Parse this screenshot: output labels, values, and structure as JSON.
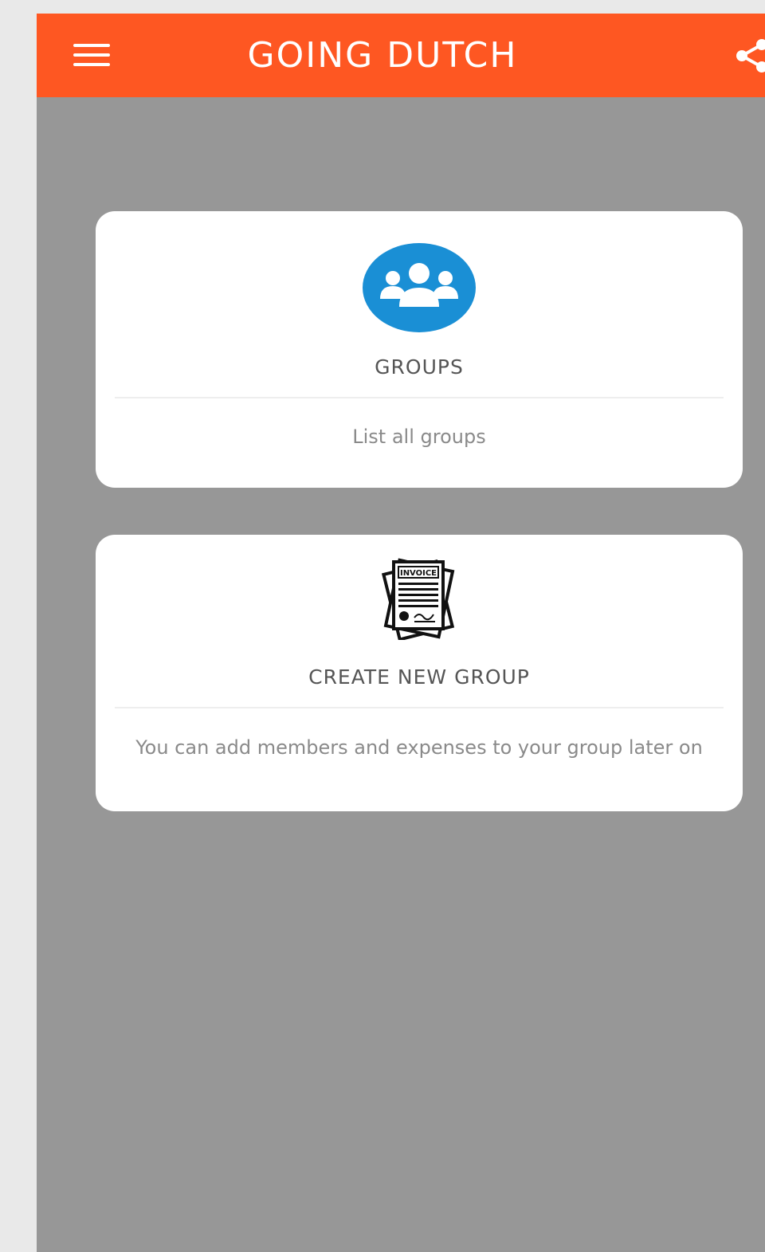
{
  "app_bar": {
    "title": "GOING DUTCH",
    "menu_icon": "hamburger-menu-icon",
    "share_icon": "share-icon",
    "background_color": "#fe5722"
  },
  "cards": {
    "groups": {
      "icon": "groups-icon",
      "icon_color": "#1a8fd5",
      "title": "GROUPS",
      "subtitle": "List all groups"
    },
    "create_group": {
      "icon": "invoice-icon",
      "icon_label": "INVOICE",
      "title": "CREATE NEW GROUP",
      "subtitle": "You can add members and expenses to your group later on"
    }
  }
}
